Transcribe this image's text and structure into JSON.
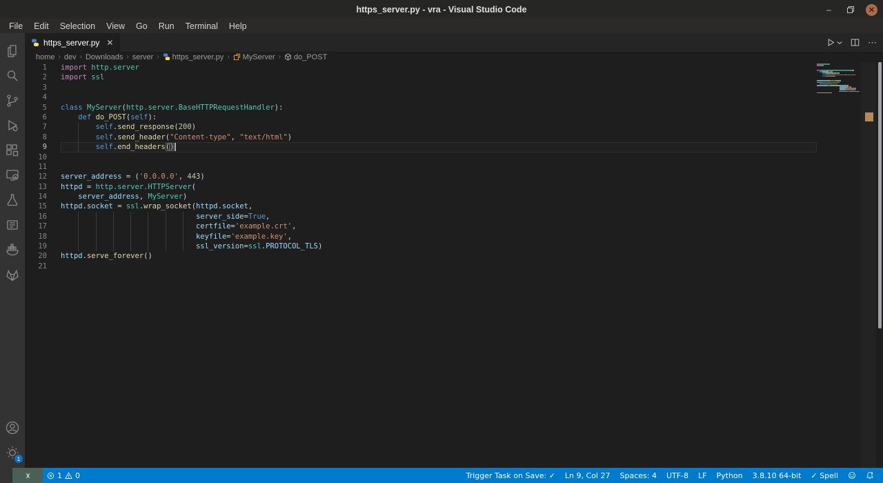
{
  "title_bar": {
    "title": "https_server.py - vra - Visual Studio Code",
    "controls": [
      {
        "name": "minimize-button",
        "icon": "minimize-icon",
        "glyph": "–"
      },
      {
        "name": "maximize-button",
        "icon": "restore-icon",
        "glyph": "❐"
      },
      {
        "name": "close-button",
        "icon": "close-icon",
        "glyph": "✕"
      }
    ]
  },
  "menu_bar": {
    "items": [
      "File",
      "Edit",
      "Selection",
      "View",
      "Go",
      "Run",
      "Terminal",
      "Help"
    ]
  },
  "activity_bar": {
    "items": [
      {
        "name": "explorer-icon",
        "title": "Explorer"
      },
      {
        "name": "search-icon",
        "title": "Search"
      },
      {
        "name": "source-control-icon",
        "title": "Source Control"
      },
      {
        "name": "run-debug-icon",
        "title": "Run and Debug"
      },
      {
        "name": "extensions-icon",
        "title": "Extensions"
      },
      {
        "name": "remote-explorer-icon",
        "title": "Remote Explorer"
      },
      {
        "name": "testing-icon",
        "title": "Testing"
      },
      {
        "name": "containers-icon",
        "title": "Containers"
      },
      {
        "name": "docker-icon",
        "title": "Docker"
      },
      {
        "name": "gitlab-icon",
        "title": "GitLab Workflow"
      }
    ],
    "bottom_items": [
      {
        "name": "accounts-icon",
        "title": "Accounts"
      },
      {
        "name": "settings-gear-icon",
        "title": "Manage",
        "badge": "1"
      }
    ]
  },
  "tab": {
    "label": "https_server.py",
    "icon": "python-file-icon",
    "close_glyph": "✕"
  },
  "editor_actions": [
    {
      "name": "run-button",
      "icon": "play-icon"
    },
    {
      "name": "run-dropdown",
      "icon": "chevron-down-icon"
    },
    {
      "name": "split-editor-button",
      "icon": "split-editor-icon"
    },
    {
      "name": "more-actions-button",
      "icon": "ellipsis-icon",
      "glyph": "⋯"
    }
  ],
  "breadcrumbs": {
    "separator": "›",
    "items": [
      {
        "label": "home"
      },
      {
        "label": "dev"
      },
      {
        "label": "Downloads"
      },
      {
        "label": "server"
      },
      {
        "label": "https_server.py",
        "icon": "python-file-icon"
      },
      {
        "label": "MyServer",
        "icon": "symbol-class-icon"
      },
      {
        "label": "do_POST",
        "icon": "symbol-method-icon"
      }
    ]
  },
  "editor": {
    "language": "python",
    "cursor": {
      "line": 9,
      "col": 27
    },
    "token_colors": {
      "kw": "#C586C0",
      "st": "#569CD6",
      "cls": "#4EC9B0",
      "fn": "#DCDCAA",
      "var": "#9CDCFE",
      "str": "#CE9178",
      "num": "#B5CEA8",
      "pun": "#D4D4D4"
    },
    "lines": [
      {
        "n": 1,
        "tokens": [
          [
            "kw",
            "import "
          ],
          [
            "cls",
            "http.server"
          ]
        ]
      },
      {
        "n": 2,
        "tokens": [
          [
            "kw",
            "import "
          ],
          [
            "cls",
            "ssl"
          ]
        ]
      },
      {
        "n": 3,
        "tokens": []
      },
      {
        "n": 4,
        "tokens": []
      },
      {
        "n": 5,
        "tokens": [
          [
            "st",
            "class "
          ],
          [
            "cls",
            "MyServer"
          ],
          [
            "pun",
            "("
          ],
          [
            "cls",
            "http.server.BaseHTTPRequestHandler"
          ],
          [
            "pun",
            "):"
          ]
        ]
      },
      {
        "n": 6,
        "tokens": [
          [
            "pun",
            "    "
          ],
          [
            "st",
            "def "
          ],
          [
            "fn",
            "do_POST"
          ],
          [
            "pun",
            "("
          ],
          [
            "st",
            "self"
          ],
          [
            "pun",
            "):"
          ]
        ]
      },
      {
        "n": 7,
        "guides": [
          4
        ],
        "tokens": [
          [
            "pun",
            "        "
          ],
          [
            "st",
            "self"
          ],
          [
            "pun",
            "."
          ],
          [
            "fn",
            "send_response"
          ],
          [
            "pun",
            "("
          ],
          [
            "num",
            "200"
          ],
          [
            "pun",
            ")"
          ]
        ]
      },
      {
        "n": 8,
        "guides": [
          4
        ],
        "tokens": [
          [
            "pun",
            "        "
          ],
          [
            "st",
            "self"
          ],
          [
            "pun",
            "."
          ],
          [
            "fn",
            "send_header"
          ],
          [
            "pun",
            "("
          ],
          [
            "str",
            "\"Content-type\""
          ],
          [
            "pun",
            ", "
          ],
          [
            "str",
            "\"text/html\""
          ],
          [
            "pun",
            ")"
          ]
        ]
      },
      {
        "n": 9,
        "current": true,
        "guides": [
          4
        ],
        "tokens": [
          [
            "pun",
            "        "
          ],
          [
            "st",
            "self"
          ],
          [
            "pun",
            "."
          ],
          [
            "fn",
            "end_headers"
          ],
          [
            "brk",
            "("
          ],
          [
            "brk",
            ")"
          ],
          [
            "cur",
            ""
          ]
        ]
      },
      {
        "n": 10,
        "tokens": []
      },
      {
        "n": 11,
        "tokens": []
      },
      {
        "n": 12,
        "tokens": [
          [
            "var",
            "server_address"
          ],
          [
            "pun",
            " = ("
          ],
          [
            "str",
            "'0.0.0.0'"
          ],
          [
            "pun",
            ", "
          ],
          [
            "num",
            "443"
          ],
          [
            "pun",
            ")"
          ]
        ]
      },
      {
        "n": 13,
        "tokens": [
          [
            "var",
            "httpd"
          ],
          [
            "pun",
            " = "
          ],
          [
            "cls",
            "http.server.HTTPServer"
          ],
          [
            "pun",
            "("
          ]
        ]
      },
      {
        "n": 14,
        "tokens": [
          [
            "pun",
            "    "
          ],
          [
            "var",
            "server_address"
          ],
          [
            "pun",
            ", "
          ],
          [
            "cls",
            "MyServer"
          ],
          [
            "pun",
            ")"
          ]
        ]
      },
      {
        "n": 15,
        "tokens": [
          [
            "var",
            "httpd"
          ],
          [
            "pun",
            "."
          ],
          [
            "var",
            "socket"
          ],
          [
            "pun",
            " = "
          ],
          [
            "cls",
            "ssl"
          ],
          [
            "pun",
            "."
          ],
          [
            "fn",
            "wrap_socket"
          ],
          [
            "pun",
            "("
          ],
          [
            "var",
            "httpd"
          ],
          [
            "pun",
            "."
          ],
          [
            "var",
            "socket"
          ],
          [
            "pun",
            ","
          ]
        ]
      },
      {
        "n": 16,
        "guides": [
          4,
          8,
          12,
          16,
          20,
          24,
          28
        ],
        "tokens": [
          [
            "pun",
            "                               "
          ],
          [
            "var",
            "server_side"
          ],
          [
            "pun",
            "="
          ],
          [
            "st",
            "True"
          ],
          [
            "pun",
            ","
          ]
        ]
      },
      {
        "n": 17,
        "guides": [
          4,
          8,
          12,
          16,
          20,
          24,
          28
        ],
        "tokens": [
          [
            "pun",
            "                               "
          ],
          [
            "var",
            "certfile"
          ],
          [
            "pun",
            "="
          ],
          [
            "str",
            "'example.crt'"
          ],
          [
            "pun",
            ","
          ]
        ]
      },
      {
        "n": 18,
        "guides": [
          4,
          8,
          12,
          16,
          20,
          24,
          28
        ],
        "tokens": [
          [
            "pun",
            "                               "
          ],
          [
            "var",
            "keyfile"
          ],
          [
            "pun",
            "="
          ],
          [
            "str",
            "'example.key'"
          ],
          [
            "pun",
            ","
          ]
        ]
      },
      {
        "n": 19,
        "guides": [
          4,
          8,
          12,
          16,
          20,
          24,
          28
        ],
        "tokens": [
          [
            "pun",
            "                               "
          ],
          [
            "var",
            "ssl_version"
          ],
          [
            "pun",
            "="
          ],
          [
            "cls",
            "ssl"
          ],
          [
            "pun",
            "."
          ],
          [
            "var",
            "PROTOCOL_TLS"
          ],
          [
            "pun",
            ")"
          ]
        ]
      },
      {
        "n": 20,
        "tokens": [
          [
            "var",
            "httpd"
          ],
          [
            "pun",
            "."
          ],
          [
            "fn",
            "serve_forever"
          ],
          [
            "pun",
            "()"
          ]
        ]
      },
      {
        "n": 21,
        "tokens": []
      }
    ]
  },
  "status_bar": {
    "remote": {
      "icon": "remote-window-icon"
    },
    "problems": {
      "errors": "1",
      "warnings": "0",
      "error_icon": "error-icon",
      "warning_icon": "warning-icon"
    },
    "right_items": [
      {
        "name": "trigger-task-status",
        "label": "Trigger Task on Save: ✓"
      },
      {
        "name": "cursor-position",
        "label": "Ln 9, Col 27"
      },
      {
        "name": "indentation",
        "label": "Spaces: 4"
      },
      {
        "name": "encoding",
        "label": "UTF-8"
      },
      {
        "name": "eol-sequence",
        "label": "LF"
      },
      {
        "name": "language-mode",
        "label": "Python"
      },
      {
        "name": "python-interpreter",
        "label": "3.8.10 64-bit"
      },
      {
        "name": "spell-checker",
        "label": "✓ Spell"
      }
    ],
    "right_icons": [
      {
        "name": "feedback-smiley-icon"
      },
      {
        "name": "notifications-bell-icon"
      }
    ]
  }
}
